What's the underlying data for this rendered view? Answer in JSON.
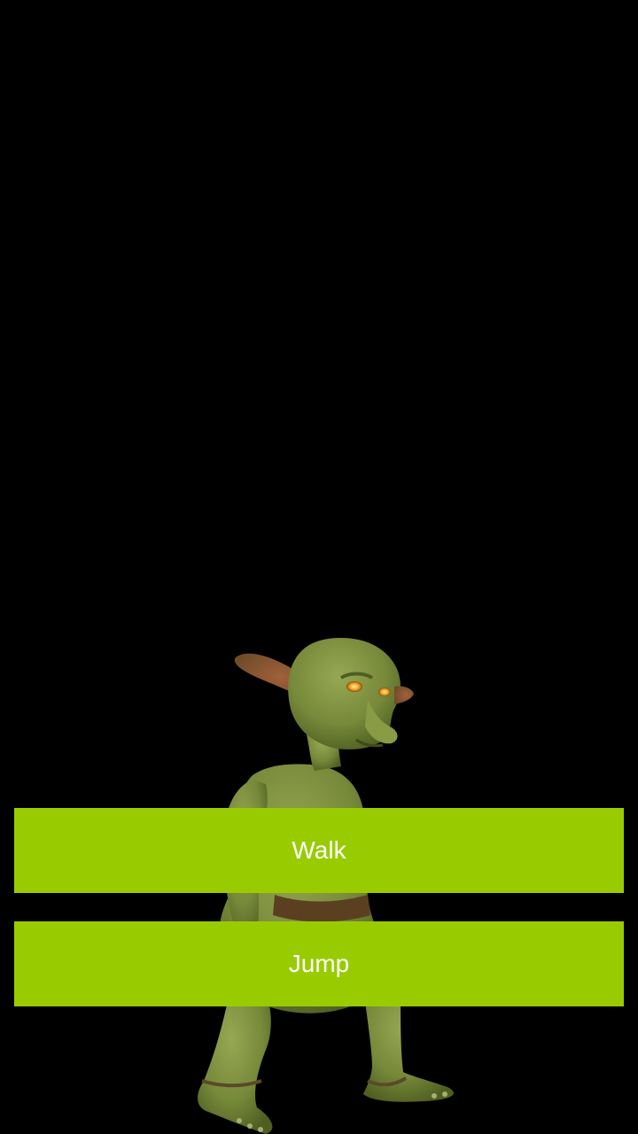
{
  "scene": {
    "background_color": "#000000",
    "character": "goblin-character",
    "character_color": "#7d8f3e"
  },
  "buttons": {
    "walk_label": "Walk",
    "jump_label": "Jump",
    "button_color": "#99cc00",
    "label_color": "#ffffff"
  }
}
